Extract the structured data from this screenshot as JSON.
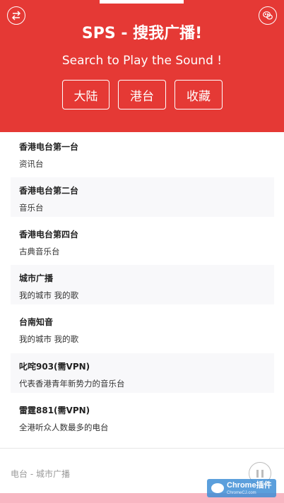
{
  "header": {
    "title": "SPS - 搜我广播!",
    "subtitle": "Search to Play the Sound !",
    "icons": {
      "left": "switch-arrows-icon",
      "right": "wechat-icon"
    },
    "nav": [
      {
        "label": "大陆"
      },
      {
        "label": "港台"
      },
      {
        "label": "收藏"
      }
    ],
    "bg_color": "#e53935"
  },
  "stations": [
    {
      "name": "香港电台第一台",
      "desc": "资讯台"
    },
    {
      "name": "香港电台第二台",
      "desc": "音乐台"
    },
    {
      "name": "香港电台第四台",
      "desc": "古典音乐台"
    },
    {
      "name": "城市广播",
      "desc": "我的城市 我的歌"
    },
    {
      "name": "台南知音",
      "desc": "我的城市 我的歌"
    },
    {
      "name": "叱咤903(需VPN)",
      "desc": "代表香港青年新势力的音乐台"
    },
    {
      "name": "雷霆881(需VPN)",
      "desc": "全港听众人数最多的电台"
    }
  ],
  "player": {
    "now_playing": "电台 - 城市广播",
    "control_icon": "pause-icon"
  },
  "watermark": {
    "main": "Chrome插件",
    "sub": "ChromeCJ.com"
  }
}
